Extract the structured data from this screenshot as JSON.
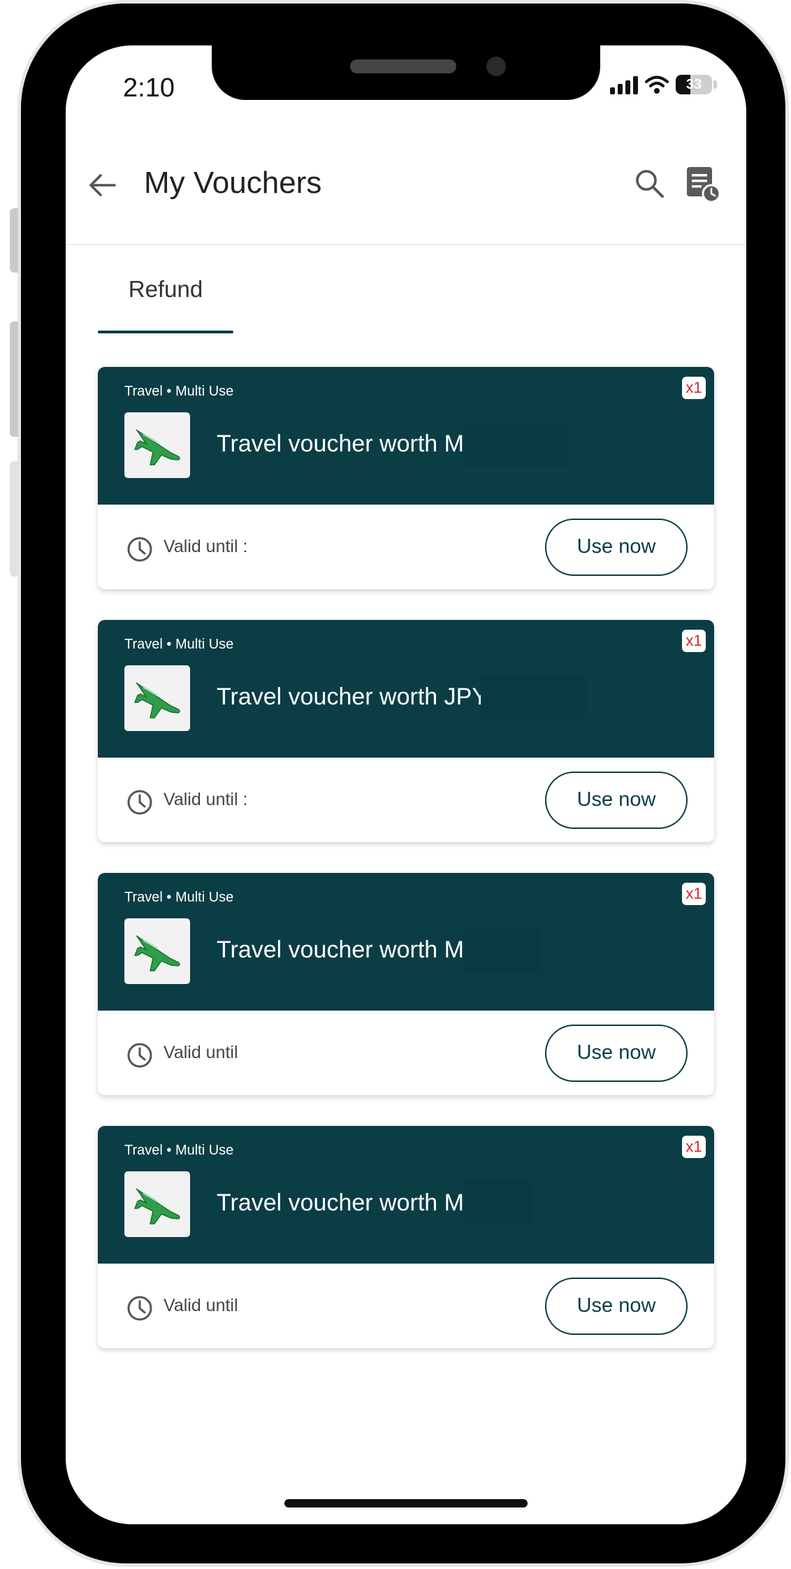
{
  "status_bar": {
    "time": "2:10",
    "battery": "33"
  },
  "header": {
    "title": "My Vouchers"
  },
  "tabs": [
    {
      "label": "Refund",
      "active": true
    }
  ],
  "vouchers": [
    {
      "category": "Travel • Multi Use",
      "title": "Travel voucher worth MYR",
      "valid": "Valid until :",
      "quantity": "x1",
      "action": "Use now"
    },
    {
      "category": "Travel • Multi Use",
      "title": "Travel voucher worth JPY",
      "valid": "Valid until :",
      "quantity": "x1",
      "action": "Use now"
    },
    {
      "category": "Travel • Multi Use",
      "title": "Travel voucher worth MYR",
      "valid": "Valid until",
      "quantity": "x1",
      "action": "Use now"
    },
    {
      "category": "Travel • Multi Use",
      "title": "Travel voucher worth MYR",
      "valid": "Valid until",
      "quantity": "x1",
      "action": "Use now"
    }
  ],
  "icons": [
    "arrow-left-icon",
    "search-icon",
    "voucher-history-icon",
    "airplane-icon",
    "clock-icon"
  ],
  "colors": {
    "card_header": "#0b3d45",
    "badge_text": "#d62a2a",
    "page": "#ffffff"
  }
}
